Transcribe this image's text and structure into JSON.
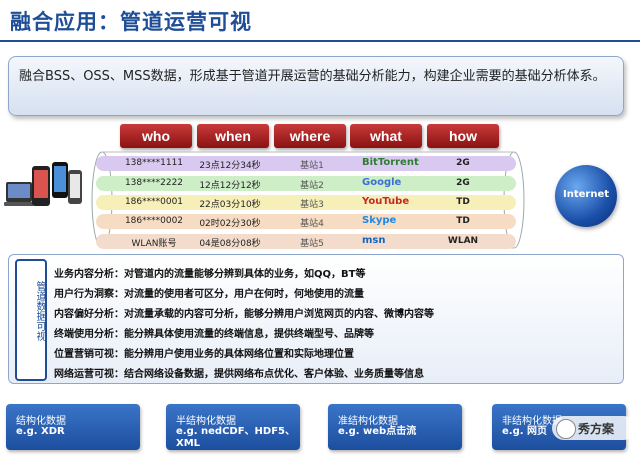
{
  "page_title": "融合应用：管道运营可视",
  "intro": "融合BSS、OSS、MSS数据，形成基于管道开展运营的基础分析能力，构建企业需要的基础分析体系。",
  "columns": [
    "who",
    "when",
    "where",
    "what",
    "how"
  ],
  "rows": [
    {
      "phone": "138****1111",
      "time": "23点12分34秒",
      "station": "基站1",
      "app": "BitTorrent",
      "net": "2G"
    },
    {
      "phone": "138****2222",
      "time": "12点12分12秒",
      "station": "基站2",
      "app": "Google",
      "net": "2G"
    },
    {
      "phone": "186****0001",
      "time": "22点03分10秒",
      "station": "基站3",
      "app": "YouTube",
      "net": "TD"
    },
    {
      "phone": "186****0002",
      "time": "02时02分30秒",
      "station": "基站4",
      "app": "Skype",
      "net": "TD"
    },
    {
      "phone": "WLAN账号",
      "time": "04是08分08秒",
      "station": "基站5",
      "app": "msn",
      "net": "WLAN"
    }
  ],
  "globe_label": "Internet",
  "side_label": "管道数据可视",
  "analysis_items": [
    "业务内容分析：对管道内的流量能够分辨到具体的业务，如QQ，BT等",
    "用户行为洞察：对流量的使用者可区分，用户在何时，何地使用的流量",
    "内容偏好分析：对流量承载的内容可分析，能够分辨用户浏览网页的内容、微博内容等",
    "终端使用分析：能分辨具体使用流量的终端信息，提供终端型号、品牌等",
    "位置营销可视：能分辨用户使用业务的具体网络位置和实际地理位置",
    "网络运营可视：结合网络设备数据，提供网络布点优化、客户体验、业务质量等信息"
  ],
  "data_types": [
    {
      "title": "结构化数据",
      "example": "e.g. XDR"
    },
    {
      "title": "半结构化数据",
      "example": "e.g. nedCDF、HDF5、XML"
    },
    {
      "title": "准结构化数据",
      "example": "e.g. web点击流"
    },
    {
      "title": "非结构化数据",
      "example": "e.g. 网页"
    }
  ],
  "watermark": "秀方案",
  "colors": {
    "accent": "#1f4e96",
    "header_red": "#a61c1c",
    "row_bands": [
      "#d9c9f0",
      "#cdeec6",
      "#f6f0b8",
      "#f7dcc4",
      "#f3dccb"
    ]
  }
}
